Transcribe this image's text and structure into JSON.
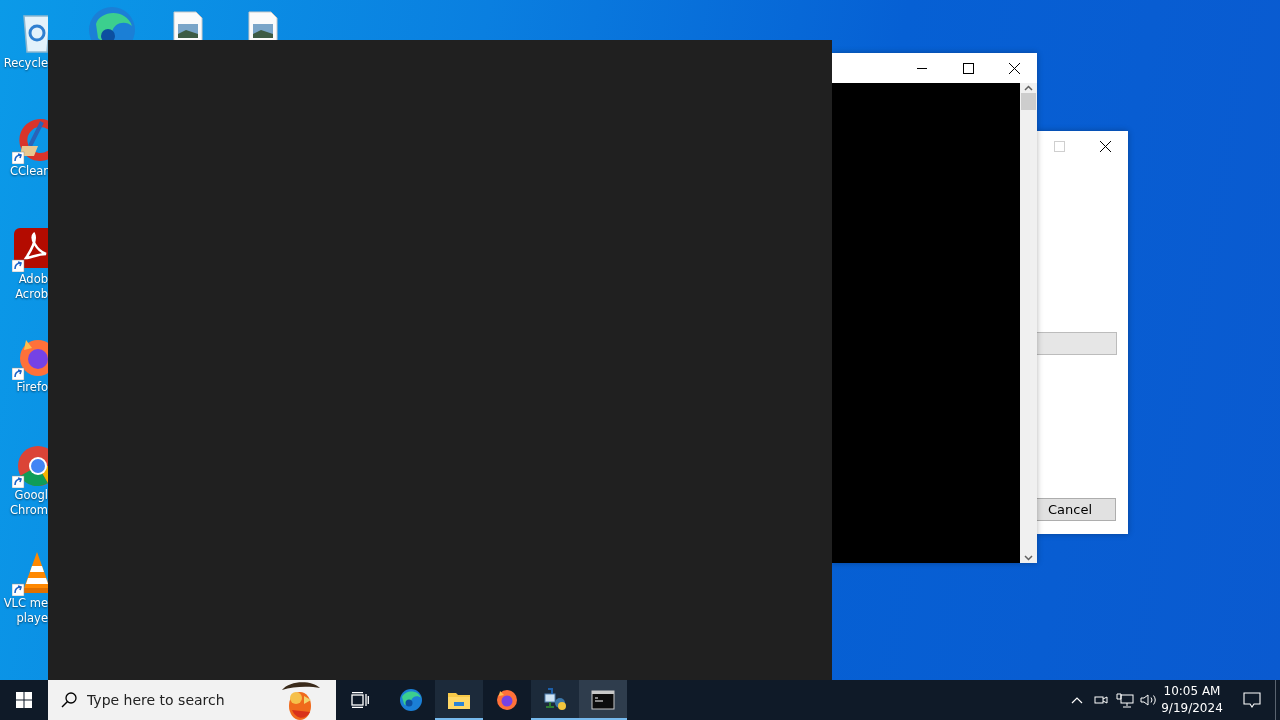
{
  "desktop": {
    "icons": [
      {
        "kind": "recycle-bin",
        "lines": [
          "Recycle"
        ],
        "shortcut": false
      },
      {
        "kind": "ccleaner",
        "lines": [
          "CClear"
        ],
        "shortcut": true
      },
      {
        "kind": "acrobat",
        "lines": [
          "Adob",
          "Acrob"
        ],
        "shortcut": true
      },
      {
        "kind": "firefox",
        "lines": [
          "Firefo"
        ],
        "shortcut": true
      },
      {
        "kind": "chrome",
        "lines": [
          "Googl",
          "Chrom"
        ],
        "shortcut": true
      },
      {
        "kind": "vlc",
        "lines": [
          "VLC me",
          "playe"
        ],
        "shortcut": true
      }
    ],
    "top_icons": [
      {
        "kind": "edge"
      },
      {
        "kind": "image-file"
      },
      {
        "kind": "image-file"
      }
    ]
  },
  "windows": [
    {
      "kind": "dialog",
      "maximize_disabled": true,
      "field": {
        "disabled": true
      },
      "buttons": [
        "Cancel"
      ]
    },
    {
      "kind": "console",
      "maximize_disabled": false
    },
    {
      "kind": "dark"
    }
  ],
  "taskbar": {
    "search": {
      "placeholder": "Type here to search"
    },
    "apps": [
      {
        "kind": "edge",
        "running": false,
        "selected": false
      },
      {
        "kind": "folder",
        "running": true,
        "selected": false
      },
      {
        "kind": "firefox",
        "running": false,
        "selected": false
      },
      {
        "kind": "python-app",
        "running": true,
        "selected": false
      },
      {
        "kind": "console",
        "running": true,
        "selected": true
      }
    ],
    "tray": {
      "time": "10:05 AM",
      "date": "9/19/2024"
    }
  }
}
